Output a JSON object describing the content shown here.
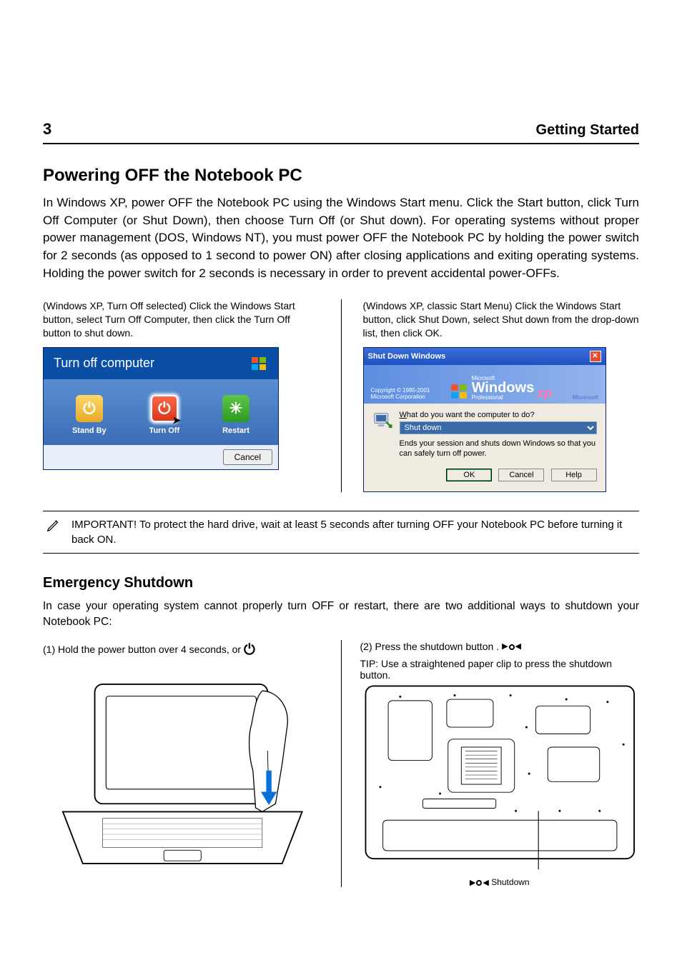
{
  "page": {
    "section_no": "3",
    "section_name": "Getting Started",
    "title": "Powering OFF the Notebook PC",
    "intro": "In Windows XP, power OFF the Notebook PC using the Windows Start menu. Click the Start button, click Turn Off Computer (or Shut Down), then choose Turn Off (or Shut down). For operating systems without proper power management (DOS, Windows NT), you must power OFF the Notebook PC by holding the power switch for 2 seconds (as opposed to 1 second to power ON) after closing applications and exiting operating systems. Holding the power switch for 2 seconds is necessary in order to prevent accidental power-OFFs.",
    "col1": "(Windows XP, Turn Off selected) Click the Windows Start button, select Turn Off Computer, then click the Turn Off button to shut down.",
    "col2": "(Windows XP, classic Start Menu) Click the Windows Start button, click Shut Down, select Shut down from the drop-down list, then click OK.",
    "note": "IMPORTANT! To protect the hard drive, wait at least 5 seconds after turning OFF your Notebook PC before turning it back ON.",
    "emergency_title": "Emergency Shutdown",
    "emergency_text": "In case your operating system cannot properly turn OFF or restart, there are two additional ways to shutdown your Notebook PC:",
    "optA": "(1) Hold the power button     over 4 seconds, or",
    "optB": "(2) Press the shutdown button      .",
    "tip": "TIP: Use a straightened paper clip to press the shutdown button.",
    "reset_label": "Shutdown",
    "side_brand": "Microsoft"
  },
  "turnoff": {
    "title": "Turn off computer",
    "standby": "Stand By",
    "turnoff": "Turn Off",
    "restart": "Restart",
    "cancel": "Cancel"
  },
  "classic": {
    "titlebar": "Shut Down Windows",
    "copyright1": "Copyright © 1985-2001",
    "copyright2": "Microsoft Corporation",
    "brand_ms": "Microsoft",
    "brand_win": "Windows",
    "brand_xp": "xp",
    "brand_prof": "Professional",
    "brand_right": "Microsoft",
    "question_pre": "W",
    "question": "hat do you want the computer to do?",
    "selected": "Shut down",
    "desc": "Ends your session and shuts down Windows so that you can safely turn off power.",
    "ok": "OK",
    "cancel": "Cancel",
    "help": "Help"
  }
}
